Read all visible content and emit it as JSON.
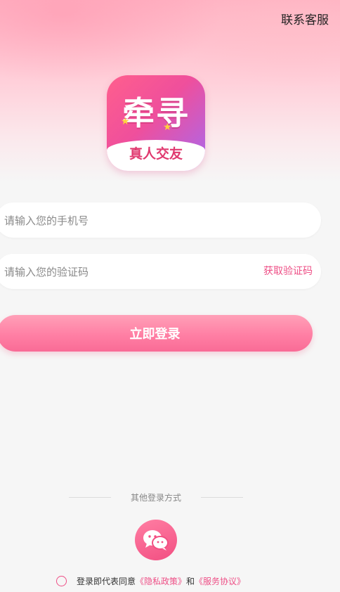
{
  "header": {
    "contact_label": "联系客服"
  },
  "logo": {
    "title": "牵寻",
    "subtitle": "真人交友"
  },
  "form": {
    "phone_placeholder": "请输入您的手机号",
    "phone_value": "",
    "code_placeholder": "请输入您的验证码",
    "code_value": "",
    "get_code_label": "获取验证码",
    "login_label": "立即登录"
  },
  "other_login": {
    "label": "其他登录方式",
    "wechat_icon": "wechat-icon"
  },
  "agreement": {
    "prefix": "登录即代表同意",
    "privacy_link": "《隐私政策》",
    "and": "和",
    "service_link": "《服务协议》",
    "checked": false
  },
  "colors": {
    "accent": "#ee4f86",
    "button": "#ff7fa4",
    "background": "#f6f6f6"
  }
}
